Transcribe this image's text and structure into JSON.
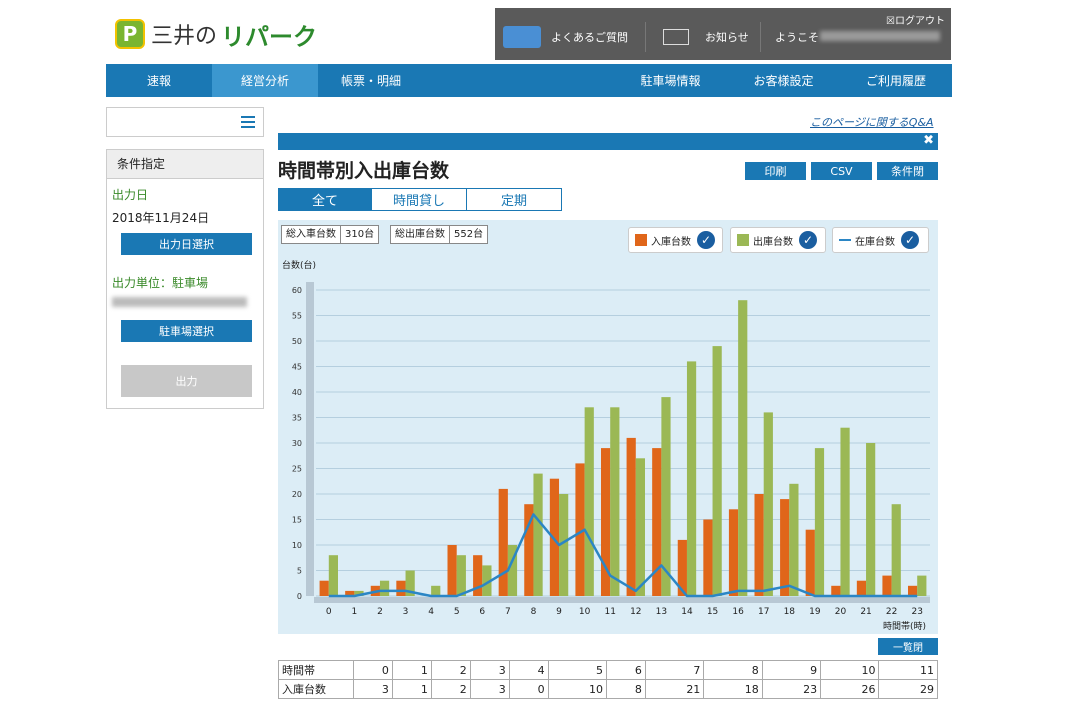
{
  "header": {
    "logo_mark": "P",
    "logo_prefix": "三井の",
    "logo_brand": "リパーク",
    "faq": "よくあるご質問",
    "notice": "お知らせ",
    "welcome": "ようこそ",
    "logout": "ログアウト"
  },
  "nav": {
    "items": [
      "速報",
      "経営分析",
      "帳票・明細",
      "駐車場情報",
      "お客様設定",
      "ご利用履歴"
    ],
    "active": "経営分析"
  },
  "sidebar": {
    "condition_title": "条件指定",
    "output_date_label": "出力日",
    "output_date_value": "2018年11月24日",
    "select_date_button": "出力日選択",
    "output_unit_label": "出力単位：駐車場",
    "select_lot_button": "駐車場選択",
    "output_button": "出力"
  },
  "main": {
    "qa_link": "このページに関するQ&A",
    "close": "✖",
    "title": "時間帯別入出庫台数",
    "buttons": {
      "print": "印刷",
      "csv": "CSV",
      "condition": "条件閉"
    },
    "tabs": [
      "全て",
      "時間貸し",
      "定期"
    ],
    "active_tab": "全て",
    "totals": {
      "in_label": "総入車台数",
      "in_value": "310台",
      "out_label": "総出庫台数",
      "out_value": "552台"
    },
    "list_button": "一覧閉"
  },
  "chart_data": {
    "type": "bar",
    "ylabel": "台数(台)",
    "xlabel": "時間帯(時)",
    "ylim": [
      0,
      60
    ],
    "yticks": [
      0,
      5,
      10,
      15,
      20,
      25,
      30,
      35,
      40,
      45,
      50,
      55,
      60
    ],
    "categories": [
      "0",
      "1",
      "2",
      "3",
      "4",
      "5",
      "6",
      "7",
      "8",
      "9",
      "10",
      "11",
      "12",
      "13",
      "14",
      "15",
      "16",
      "17",
      "18",
      "19",
      "20",
      "21",
      "22",
      "23"
    ],
    "series": [
      {
        "name": "入庫台数",
        "type": "bar",
        "color": "#e0661a",
        "values": [
          3,
          1,
          2,
          3,
          0,
          10,
          8,
          21,
          18,
          23,
          26,
          29,
          31,
          29,
          11,
          15,
          17,
          20,
          19,
          13,
          2,
          3,
          4,
          2
        ]
      },
      {
        "name": "出庫台数",
        "type": "bar",
        "color": "#9bb855",
        "values": [
          8,
          1,
          3,
          5,
          2,
          8,
          6,
          10,
          24,
          20,
          37,
          37,
          27,
          39,
          46,
          49,
          58,
          36,
          22,
          29,
          33,
          30,
          18,
          4
        ]
      },
      {
        "name": "在庫台数",
        "type": "line",
        "color": "#2b86c5",
        "values": [
          0,
          0,
          1,
          1,
          0,
          0,
          2,
          5,
          16,
          10,
          13,
          4,
          1,
          6,
          0,
          0,
          1,
          1,
          2,
          0,
          0,
          0,
          0,
          0
        ]
      }
    ],
    "legend_position": "top-right",
    "grid": true
  },
  "table": {
    "rows": [
      {
        "label": "時間帯",
        "values": [
          "0",
          "1",
          "2",
          "3",
          "4",
          "5",
          "6",
          "7",
          "8",
          "9",
          "10",
          "11"
        ]
      },
      {
        "label": "入庫台数",
        "values": [
          "3",
          "1",
          "2",
          "3",
          "0",
          "10",
          "8",
          "21",
          "18",
          "23",
          "26",
          "29"
        ]
      }
    ]
  },
  "colors": {
    "brand": "#1a78b4",
    "green": "#2d8a2d",
    "chart_bg": "#dcedf6"
  }
}
